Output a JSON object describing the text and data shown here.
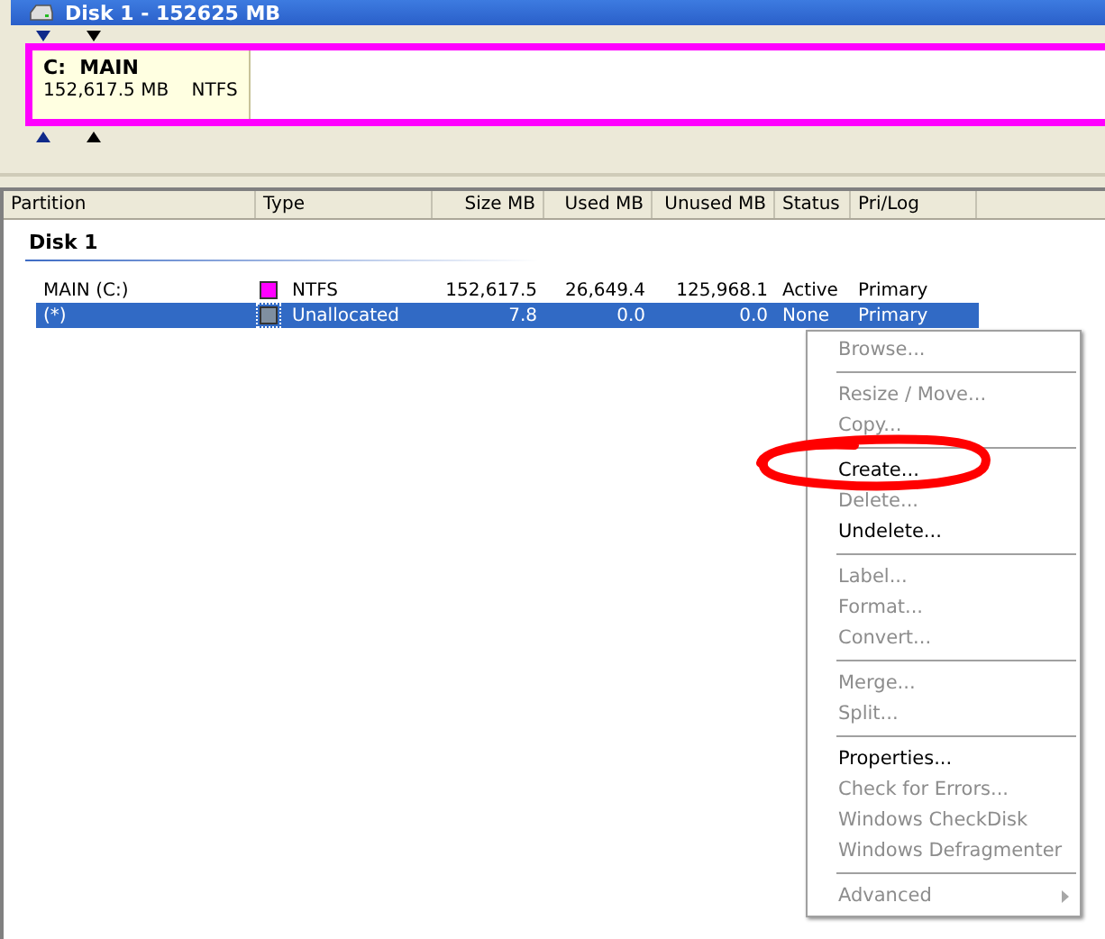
{
  "title_bar": {
    "title": "Disk 1 - 152625 MB"
  },
  "disk_map": {
    "partitions": [
      {
        "drive": "C:",
        "label": "MAIN",
        "size": "152,617.5 MB",
        "fs": "NTFS",
        "color": "#ff00ff"
      }
    ]
  },
  "table": {
    "columns": [
      {
        "label": "Partition"
      },
      {
        "label": "Type"
      },
      {
        "label": "Size MB"
      },
      {
        "label": "Used MB"
      },
      {
        "label": "Unused MB"
      },
      {
        "label": "Status"
      },
      {
        "label": "Pri/Log"
      }
    ],
    "group": "Disk 1",
    "rows": [
      {
        "partition": "MAIN (C:)",
        "type": "NTFS",
        "color": "#ff00ff",
        "size": "152,617.5",
        "used": "26,649.4",
        "unused": "125,968.1",
        "status": "Active",
        "prilog": "Primary",
        "selected": false
      },
      {
        "partition": "(*)",
        "type": "Unallocated",
        "color": "#7f8fa0",
        "size": "7.8",
        "used": "0.0",
        "unused": "0.0",
        "status": "None",
        "prilog": "Primary",
        "selected": true
      }
    ]
  },
  "context_menu": {
    "items": [
      {
        "kind": "item",
        "label": "Browse...",
        "disabled": true
      },
      {
        "kind": "separator"
      },
      {
        "kind": "item",
        "label": "Resize / Move...",
        "disabled": true
      },
      {
        "kind": "item",
        "label": "Copy...",
        "disabled": true
      },
      {
        "kind": "separator"
      },
      {
        "kind": "item",
        "label": "Create...",
        "disabled": false
      },
      {
        "kind": "item",
        "label": "Delete...",
        "disabled": true
      },
      {
        "kind": "item",
        "label": "Undelete...",
        "disabled": false
      },
      {
        "kind": "separator"
      },
      {
        "kind": "item",
        "label": "Label...",
        "disabled": true
      },
      {
        "kind": "item",
        "label": "Format...",
        "disabled": true
      },
      {
        "kind": "item",
        "label": "Convert...",
        "disabled": true
      },
      {
        "kind": "separator"
      },
      {
        "kind": "item",
        "label": "Merge...",
        "disabled": true
      },
      {
        "kind": "item",
        "label": "Split...",
        "disabled": true
      },
      {
        "kind": "separator"
      },
      {
        "kind": "item",
        "label": "Properties...",
        "disabled": false
      },
      {
        "kind": "item",
        "label": "Check for Errors...",
        "disabled": true
      },
      {
        "kind": "item",
        "label": "Windows CheckDisk",
        "disabled": true
      },
      {
        "kind": "item",
        "label": "Windows Defragmenter",
        "disabled": true
      },
      {
        "kind": "separator"
      },
      {
        "kind": "submenu",
        "label": "Advanced",
        "disabled": true
      }
    ]
  }
}
